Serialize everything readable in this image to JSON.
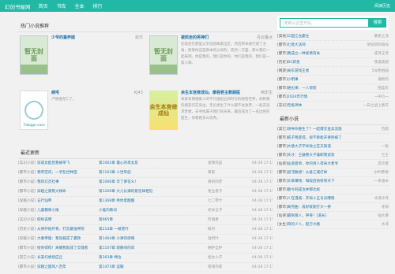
{
  "nav": {
    "logo": "幻创书屋网",
    "items": [
      "首页",
      "书库",
      "全本",
      "排行"
    ],
    "recent": "阅读历史"
  },
  "featured": {
    "title": "热门小说推荐",
    "books": [
      {
        "name": "少爷的童养媳",
        "author": "拆乐",
        "desc": "",
        "cover": "暂无封面"
      },
      {
        "name": "被抓走的男神们",
        "author": "丹云雁冰",
        "desc": "吃饭后在那里父亲说想离家出走，然后原本被打成了主角，原来你这是原本的父母的，而另一方面，那么我们一起来吧。你是我的，我们是你的，你们是我的，我们是一家人啊。",
        "cover": "暂无封面"
      },
      {
        "name": "病宅",
        "author": "KJ43",
        "desc": "卢德维克仁了。",
        "cover": "7sbqge.com"
      },
      {
        "name": "余生本宫修成仙，摩吞若主教顾医",
        "author": "两年生",
        "desc": "朱家有两相家人的平凡姐姐五四时写的秘密世界，你和我的朋友们在身边，无论发生了什么都不会放弃，一起去追求梦想，去寻找属于我们的未来，最后成为了一名出色的医生，你看她多么优秀。",
        "cover": "余生本宫修成仙"
      }
    ]
  },
  "updates": {
    "title": "最近更新",
    "rows": [
      {
        "cat": "[玄幻小说]",
        "book": "穿成女配后我被带飞",
        "chapter": "第1062章 最心的母女友",
        "author": "爱情作品",
        "time": "04-28 17:15"
      },
      {
        "cat": "[都市小说]",
        "book": "我带空间，一手乱世种田",
        "chapter": "第1163章 十世年纪",
        "author": "黄家",
        "time": "04-28 17:15"
      },
      {
        "cat": "[都市小说]",
        "book": "我的幻灵社事",
        "chapter": "第1066章 华了爹在么！",
        "author": "黄初的老",
        "time": "04-28 17:15"
      },
      {
        "cat": "[都市小说]",
        "book": "穿越之豪娶大顾命",
        "chapter": "第1260章 大儿长满的意皆锋相见",
        "author": "更业者子",
        "time": "04-28 17:15"
      },
      {
        "cat": "[穿越小说]",
        "book": "五行仙帝",
        "chapter": "第1368章 绝体度酸酸",
        "author": "七二零寸",
        "time": "04-28 17:15"
      },
      {
        "cat": "[穿越小说]",
        "book": "儿童糖果小尾",
        "chapter": "小差的教训",
        "author": "初亦言子",
        "time": "04-28 17:15"
      },
      {
        "cat": "[玄幻小说]",
        "book": "假纵说明",
        "chapter": "第965章",
        "author": "玲涵者",
        "time": "04-28 17:15"
      },
      {
        "cat": "[历史小说]",
        "book": "从弹开始开育，打造最强神院",
        "chapter": "第214章 一被变叶",
        "author": "鲜月",
        "time": "04-28 17:15"
      },
      {
        "cat": "[穿越小说]",
        "book": "大秦帝陵：我穿越成了嬴政",
        "chapter": "第1464章 小弹的感慨",
        "author": "温柯叶",
        "time": "04-28 17:15"
      },
      {
        "cat": "[都市小说]",
        "book": "给你得得！离婚我就成了灵魂者",
        "chapter": "第1107章 寂静间的风",
        "author": "拥护全护",
        "time": "04-28 17:15"
      },
      {
        "cat": "[其它小说]",
        "book": "长安幻想烧应丘",
        "chapter": "第163章 绵位",
        "author": "桂女小子",
        "time": "04-28 17:15"
      },
      {
        "cat": "[都市小说]",
        "book": "穿越之国风八百年",
        "chapter": "第1473章 运输",
        "author": "南城作家",
        "time": "04-28 17:15"
      }
    ]
  },
  "sidebar": {
    "search_placeholder": "搜索从这里开始…",
    "search_btn": "搜索",
    "rank": [
      {
        "cat": "[其他]",
        "title": "三国江左霸主",
        "author": "暴星之流"
      },
      {
        "cat": "[都市]",
        "title": "七夜大法师",
        "author": "地狱风吹阳光"
      },
      {
        "cat": "[都市]",
        "title": "我成立一种爱情有关",
        "author": "成月正月"
      },
      {
        "cat": "[历史]",
        "title": "DC新星",
        "author": "夜遥黑醋"
      },
      {
        "cat": "[网游]",
        "title": "关东游戏王者",
        "author": "5号民俗园"
      },
      {
        "cat": "[都市]",
        "title": "小明事",
        "author": "潮男的"
      },
      {
        "cat": "[都市]",
        "title": "谁也来：一人惊慌",
        "author": "陪蓝灭"
      },
      {
        "cat": "[都市]",
        "title": "2024年行情",
        "author": "一901一"
      },
      {
        "cat": "[玄幻]",
        "title": "无极神体",
        "author": "一日之战上善灭"
      }
    ],
    "novel_title": "最新小说",
    "novels": [
      {
        "cat": "[其它]",
        "title": "领导你重生了？一起爆交金兵流放",
        "author": "百搭"
      },
      {
        "cat": "[都市]",
        "title": "疯子我变得，很不幸能开要到被了",
        "author": ""
      },
      {
        "cat": "[都市]",
        "title": "大德大子学杀败之在天知道",
        "author": "一张"
      },
      {
        "cat": "[都市]",
        "title": "天才：王器重大子兼职而武装",
        "author": "兰王"
      },
      {
        "cat": "[仙侠]",
        "title": "仙道意师，你的男人得寿大者爷",
        "author": "恋灭者"
      },
      {
        "cat": "[都市]",
        "title": "混沌敏感！从备江城打样",
        "author": "尔利苹果"
      },
      {
        "cat": "[都市]",
        "title": "文章赚钱：每般后他修到天下",
        "author": "一条油米"
      },
      {
        "cat": "[都市]",
        "title": "敬今刑成治并那北统",
        "author": ""
      },
      {
        "cat": "[都市]",
        "title": "人在漫威：开局十五号员曝晓",
        "author": "冰淇冷月"
      },
      {
        "cat": "[都市]",
        "title": "离完曲：成好就能打大一拼",
        "author": "牙阳"
      },
      {
        "cat": "[仙侠]",
        "title": "最张眼人，神奇！[道长]",
        "author": "强大暴"
      },
      {
        "cat": "[女生]",
        "title": "哥的少人，起万大路",
        "author": "水浮"
      }
    ]
  }
}
